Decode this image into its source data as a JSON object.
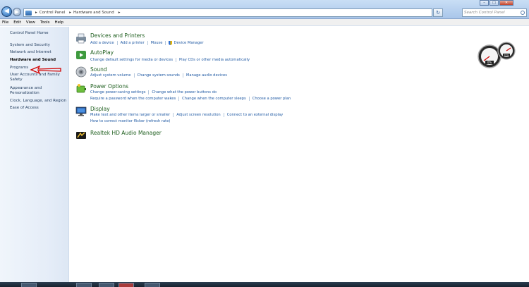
{
  "window": {
    "minimize": "–",
    "maximize": "□",
    "close": "✕"
  },
  "address": {
    "root": "Control Panel",
    "current": "Hardware and Sound"
  },
  "search": {
    "placeholder": "Search Control Panel"
  },
  "menu": [
    "File",
    "Edit",
    "View",
    "Tools",
    "Help"
  ],
  "sidebar": {
    "items": [
      {
        "label": "Control Panel Home"
      },
      {
        "label": "System and Security"
      },
      {
        "label": "Network and Internet"
      },
      {
        "label": "Hardware and Sound"
      },
      {
        "label": "Programs"
      },
      {
        "label": "User Accounts and Family Safety"
      },
      {
        "label": "Appearance and Personalization"
      },
      {
        "label": "Clock, Language, and Region"
      },
      {
        "label": "Ease of Access"
      }
    ]
  },
  "categories": [
    {
      "title": "Devices and Printers",
      "icon": "printer-icon",
      "rows": [
        [
          "Add a device",
          "Add a printer",
          "Mouse",
          "Device Manager"
        ]
      ]
    },
    {
      "title": "AutoPlay",
      "icon": "autoplay-icon",
      "rows": [
        [
          "Change default settings for media or devices",
          "Play CDs or other media automatically"
        ]
      ]
    },
    {
      "title": "Sound",
      "icon": "speaker-icon",
      "rows": [
        [
          "Adjust system volume",
          "Change system sounds",
          "Manage audio devices"
        ]
      ]
    },
    {
      "title": "Power Options",
      "icon": "battery-icon",
      "rows": [
        [
          "Change power-saving settings",
          "Change what the power buttons do"
        ],
        [
          "Require a password when the computer wakes",
          "Change when the computer sleeps",
          "Choose a power plan"
        ]
      ]
    },
    {
      "title": "Display",
      "icon": "monitor-icon",
      "rows": [
        [
          "Make text and other items larger or smaller",
          "Adjust screen resolution",
          "Connect to an external display"
        ],
        [
          "How to correct monitor flicker (refresh rate)"
        ]
      ]
    },
    {
      "title": "Realtek HD Audio Manager",
      "icon": "realtek-icon",
      "rows": []
    }
  ],
  "gadget": {
    "cpu": "0%",
    "mem": "31%"
  }
}
